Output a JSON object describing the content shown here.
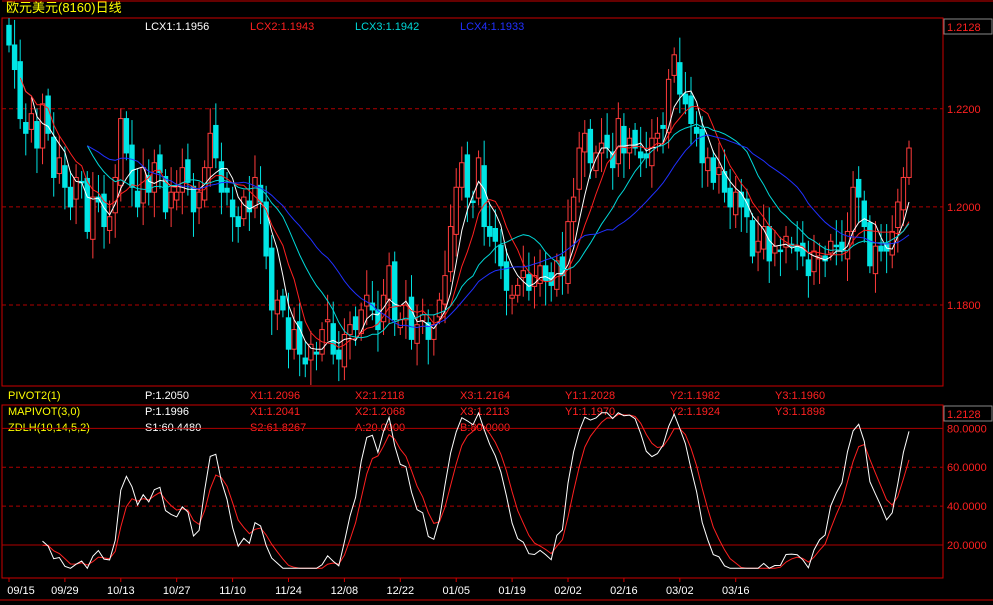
{
  "window": {
    "title": "欧元美元(8160)日线"
  },
  "colors": {
    "up": "#ff3b3b",
    "down": "#00e5e5",
    "frame": "#cc0000",
    "grid": "#b00000",
    "lcx1": "#ffffff",
    "lcx2": "#ff2020",
    "lcx3": "#00d8d8",
    "lcx4": "#2030ff",
    "ind_label": "#ffff00",
    "white_text": "#ffffff",
    "red_text": "#ff2020",
    "k_line": "#ffffff",
    "d_line": "#ff2020"
  },
  "main_panel": {
    "legend": [
      {
        "text": "LCX1:1.1956",
        "color": "#ffffff"
      },
      {
        "text": "LCX2:1.1943",
        "color": "#ff2020"
      },
      {
        "text": "LCX3:1.1942",
        "color": "#00d8d8"
      },
      {
        "text": "LCX4:1.1933",
        "color": "#2030ff"
      }
    ],
    "top_price": "1.2128",
    "price_ticks": [
      "1.2200",
      "1.2000",
      "1.1800"
    ]
  },
  "indicator_rows": [
    {
      "name": "PIVOT2(1)",
      "values": [
        {
          "text": "P:1.2050",
          "color": "#ffffff"
        },
        {
          "text": "X1:1.2096",
          "color": "#ff2020"
        },
        {
          "text": "X2:1.2118",
          "color": "#ff2020"
        },
        {
          "text": "X3:1.2164",
          "color": "#ff2020"
        },
        {
          "text": "Y1:1.2028",
          "color": "#ff2020"
        },
        {
          "text": "Y2:1.1982",
          "color": "#ff2020"
        },
        {
          "text": "Y3:1.1960",
          "color": "#ff2020"
        }
      ]
    },
    {
      "name": "MAPIVOT(3,0)",
      "values": [
        {
          "text": "P:1.1996",
          "color": "#ffffff"
        },
        {
          "text": "X1:1.2041",
          "color": "#ff2020"
        },
        {
          "text": "X2:1.2068",
          "color": "#ff2020"
        },
        {
          "text": "X3:1.2113",
          "color": "#ff2020"
        },
        {
          "text": "Y1:1.1970",
          "color": "#ff2020"
        },
        {
          "text": "Y2:1.1924",
          "color": "#ff2020"
        },
        {
          "text": "Y3:1.1898",
          "color": "#ff2020"
        }
      ]
    },
    {
      "name": "ZDLH(10,14,5,2)",
      "values": [
        {
          "text": "S1:60.4480",
          "color": "#ffffff"
        },
        {
          "text": "S2:61.8267",
          "color": "#ff2020"
        },
        {
          "text": "A:20.0000",
          "color": "#ff2020"
        },
        {
          "text": "B:80.0000",
          "color": "#ff2020"
        }
      ]
    }
  ],
  "sub_panel": {
    "top_value": "1.2128",
    "ticks": [
      "80.0000",
      "60.0000",
      "40.0000",
      "20.0000"
    ]
  },
  "x_axis": {
    "labels": [
      "09/15",
      "09/29",
      "10/13",
      "10/27",
      "11/10",
      "11/24",
      "12/08",
      "12/22",
      "01/05",
      "01/19",
      "02/02",
      "02/16",
      "03/02",
      "03/16"
    ]
  },
  "chart_data": [
    {
      "type": "candlestick",
      "series_name": "欧元美元(8160)日线",
      "y_ticks": [
        1.22,
        1.2,
        1.18
      ],
      "ylim": [
        1.1635,
        1.2385
      ],
      "x_labels": [
        "09/15",
        "09/29",
        "10/13",
        "10/27",
        "11/10",
        "11/24",
        "12/08",
        "12/22",
        "01/05",
        "01/19",
        "02/02",
        "02/16",
        "03/02",
        "03/16"
      ],
      "x_label_index": [
        0,
        10,
        20,
        30,
        40,
        50,
        60,
        70,
        80,
        90,
        100,
        110,
        120,
        130
      ],
      "close": [
        1.233,
        1.228,
        1.218,
        1.215,
        1.219,
        1.212,
        1.221,
        1.215,
        1.206,
        1.21,
        1.204,
        1.2,
        1.206,
        1.205,
        1.195,
        1.202,
        1.201,
        1.196,
        1.198,
        1.206,
        1.218,
        1.211,
        1.204,
        1.2,
        1.208,
        1.203,
        1.209,
        1.207,
        1.199,
        1.203,
        1.203,
        1.208,
        1.205,
        1.199,
        1.203,
        1.208,
        1.215,
        1.21,
        1.203,
        1.203,
        1.198,
        1.196,
        1.202,
        1.199,
        1.206,
        1.201,
        1.19,
        1.179,
        1.181,
        1.179,
        1.171,
        1.175,
        1.17,
        1.168,
        1.172,
        1.17,
        1.175,
        1.177,
        1.17,
        1.169,
        1.174,
        1.176,
        1.175,
        1.179,
        1.182,
        1.179,
        1.175,
        1.182,
        1.188,
        1.177,
        1.177,
        1.18,
        1.173,
        1.176,
        1.178,
        1.173,
        1.176,
        1.181,
        1.186,
        1.196,
        1.204,
        1.209,
        1.202,
        1.201,
        1.21,
        1.196,
        1.194,
        1.193,
        1.188,
        1.183,
        1.182,
        1.184,
        1.187,
        1.183,
        1.186,
        1.188,
        1.185,
        1.184,
        1.189,
        1.186,
        1.197,
        1.202,
        1.212,
        1.215,
        1.209,
        1.211,
        1.213,
        1.212,
        1.208,
        1.218,
        1.211,
        1.214,
        1.212,
        1.21,
        1.21,
        1.214,
        1.215,
        1.216,
        1.226,
        1.231,
        1.223,
        1.221,
        1.217,
        1.215,
        1.209,
        1.21,
        1.205,
        1.208,
        1.203,
        1.2,
        1.203,
        1.2,
        1.198,
        1.19,
        1.193,
        1.196,
        1.189,
        1.192,
        1.191,
        1.194,
        1.192,
        1.191,
        1.19,
        1.186,
        1.191,
        1.19,
        1.189,
        1.193,
        1.192,
        1.191,
        1.195,
        1.204,
        1.202,
        1.196,
        1.188,
        1.192,
        1.191,
        1.191,
        1.195,
        1.201,
        1.206,
        1.212
      ],
      "series": [
        {
          "name": "LCX1",
          "last": 1.1956
        },
        {
          "name": "LCX2",
          "last": 1.1943
        },
        {
          "name": "LCX3",
          "last": 1.1942
        },
        {
          "name": "LCX4",
          "last": 1.1933
        }
      ]
    },
    {
      "type": "line",
      "series_name": "ZDLH(10,14,5,2)",
      "y_ticks": [
        80,
        60,
        40,
        20
      ],
      "ylim": [
        3,
        92
      ],
      "series": [
        {
          "name": "S1",
          "last": 60.448
        },
        {
          "name": "S2",
          "last": 61.8267
        }
      ]
    }
  ]
}
